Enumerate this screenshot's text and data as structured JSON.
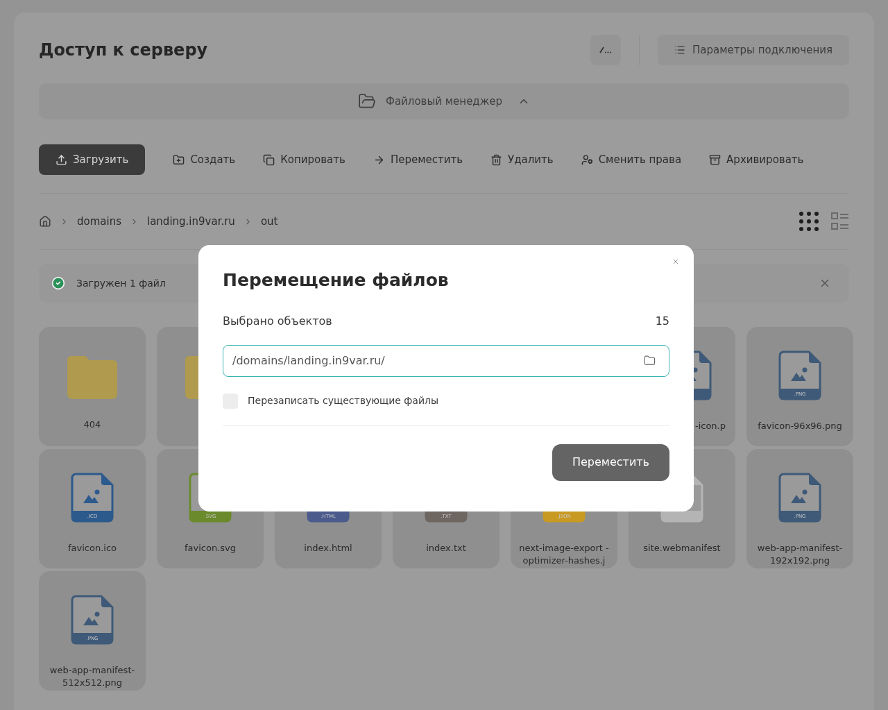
{
  "header": {
    "title": "Доступ к серверу",
    "connection_button": "Параметры подключения"
  },
  "file_manager_bar": {
    "label": "Файловый менеджер",
    "expanded": true
  },
  "toolbar": [
    {
      "label": "Загрузить",
      "kind": "upload",
      "primary": true
    },
    {
      "label": "Создать",
      "kind": "create",
      "primary": false
    },
    {
      "label": "Копировать",
      "kind": "copy",
      "primary": false
    },
    {
      "label": "Переместить",
      "kind": "move",
      "primary": false
    },
    {
      "label": "Удалить",
      "kind": "delete",
      "primary": false
    },
    {
      "label": "Сменить права",
      "kind": "permissions",
      "primary": false
    },
    {
      "label": "Архивировать",
      "kind": "archive",
      "primary": false
    }
  ],
  "breadcrumbs": [
    "domains",
    "landing.in9var.ru",
    "out"
  ],
  "view_modes": [
    {
      "kind": "grid",
      "selected": true
    },
    {
      "kind": "list",
      "selected": false
    }
  ],
  "notification": {
    "text": "Загружен 1 файл"
  },
  "files": [
    {
      "kind": "folder",
      "name": "404"
    },
    {
      "kind": "folder"
    },
    {
      "kind": "empty"
    },
    {
      "kind": "empty"
    },
    {
      "kind": "empty"
    },
    {
      "kind": "clipped",
      "color": "#3f5a78",
      "name": "-icon.p"
    },
    {
      "kind": "file",
      "ext": ".PNG",
      "color": "#3f5a78",
      "name": "favicon-96x96.png"
    },
    {
      "kind": "file",
      "ext": ".ICO",
      "color": "#2d5a8c",
      "name": "favicon.ico"
    },
    {
      "kind": "file",
      "ext": ".SVG",
      "color": "#6b8a2c",
      "name": "favicon.svg"
    },
    {
      "kind": "file",
      "ext": ".HTML",
      "color": "#4b5b8c",
      "name": "index.html"
    },
    {
      "kind": "file",
      "ext": ".TXT",
      "color": "#6e6660",
      "name": "index.txt"
    },
    {
      "kind": "file",
      "ext": ".JSON",
      "color": "#c99a22",
      "name": "next-image-export -optimizer-hashes.j"
    },
    {
      "kind": "file",
      "color": "#b4b4b4",
      "name": "site.webmanifest"
    },
    {
      "kind": "file",
      "ext": ".PNG",
      "color": "#3f5a78",
      "name": "web-app-manifest-192x192.png"
    },
    {
      "kind": "file",
      "ext": ".PNG",
      "color": "#3f5a78",
      "name": "web-app-manifest-512x512.png"
    }
  ],
  "dialog": {
    "title": "Перемещение файлов",
    "selected_label": "Выбрано объектов",
    "selected_count": "15",
    "path_value": "/domains/landing.in9var.ru/",
    "overwrite": {
      "label": "Перезаписать существующие файлы",
      "checked": false
    },
    "submit": "Переместить"
  }
}
